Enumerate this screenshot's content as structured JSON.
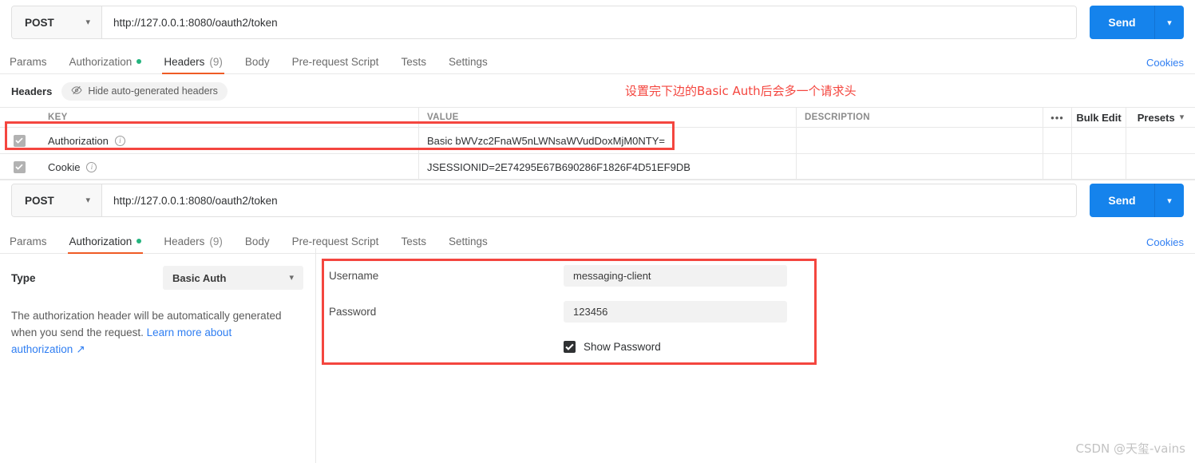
{
  "panel_top": {
    "request": {
      "method": "POST",
      "url": "http://127.0.0.1:8080/oauth2/token",
      "send_label": "Send"
    },
    "tabs": [
      {
        "label": "Params",
        "active": false,
        "dot": false,
        "count": ""
      },
      {
        "label": "Authorization",
        "active": false,
        "dot": true,
        "count": ""
      },
      {
        "label": "Headers",
        "active": true,
        "dot": false,
        "count": "(9)"
      },
      {
        "label": "Body",
        "active": false,
        "dot": false,
        "count": ""
      },
      {
        "label": "Pre-request Script",
        "active": false,
        "dot": false,
        "count": ""
      },
      {
        "label": "Tests",
        "active": false,
        "dot": false,
        "count": ""
      },
      {
        "label": "Settings",
        "active": false,
        "dot": false,
        "count": ""
      }
    ],
    "cookies_link": "Cookies",
    "subbar": {
      "title": "Headers",
      "hide_auto_label": "Hide auto-generated headers"
    },
    "table": {
      "columns": [
        "KEY",
        "VALUE",
        "DESCRIPTION"
      ],
      "dots_label": "•••",
      "bulk_edit_label": "Bulk Edit",
      "presets_label": "Presets",
      "rows": [
        {
          "checked": true,
          "key": "Authorization",
          "value": "Basic bWVzc2FnaW5nLWNsaWVudDoxMjM0NTY=",
          "description": ""
        },
        {
          "checked": true,
          "key": "Cookie",
          "value": "JSESSIONID=2E74295E67B690286F1826F4D51EF9DB",
          "description": ""
        }
      ]
    }
  },
  "panel_bottom": {
    "request": {
      "method": "POST",
      "url": "http://127.0.0.1:8080/oauth2/token",
      "send_label": "Send"
    },
    "tabs": [
      {
        "label": "Params",
        "active": false,
        "dot": false,
        "count": ""
      },
      {
        "label": "Authorization",
        "active": true,
        "dot": true,
        "count": ""
      },
      {
        "label": "Headers",
        "active": false,
        "dot": false,
        "count": "(9)"
      },
      {
        "label": "Body",
        "active": false,
        "dot": false,
        "count": ""
      },
      {
        "label": "Pre-request Script",
        "active": false,
        "dot": false,
        "count": ""
      },
      {
        "label": "Tests",
        "active": false,
        "dot": false,
        "count": ""
      },
      {
        "label": "Settings",
        "active": false,
        "dot": false,
        "count": ""
      }
    ],
    "cookies_link": "Cookies",
    "auth": {
      "type_label": "Type",
      "type_value": "Basic Auth",
      "help_text": "The authorization header will be automatically generated when you send the request. ",
      "help_link": "Learn more about authorization",
      "help_link_arrow": "↗",
      "username_label": "Username",
      "username_value": "messaging-client",
      "password_label": "Password",
      "password_value": "123456",
      "show_password_label": "Show Password",
      "show_password_checked": true
    }
  },
  "annotations": {
    "note_text": "设置完下边的Basic Auth后会多一个请求头",
    "color": "#f4463f"
  },
  "watermark": "CSDN @天玺-vains",
  "theme": {
    "accent_orange": "#ef5b25",
    "send_blue": "#1583ec",
    "link_blue": "#2f7ef2",
    "dot_green": "#24b47e",
    "annotation_red": "#f4463f"
  }
}
